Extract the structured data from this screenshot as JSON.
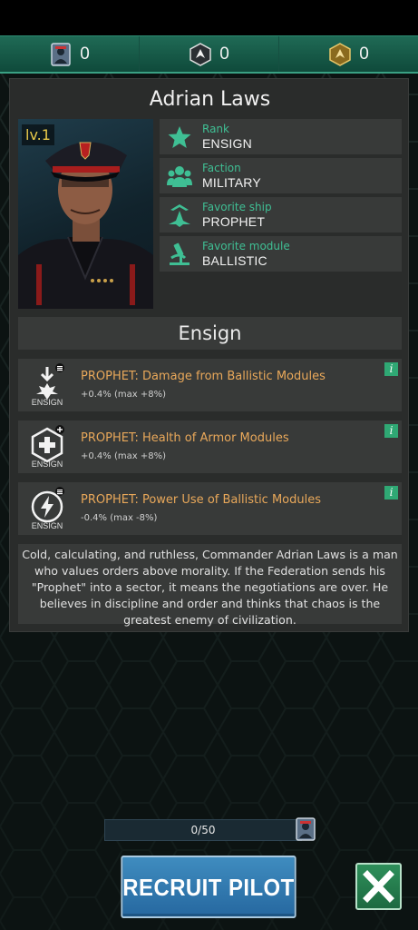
{
  "resources": [
    {
      "icon": "pilot-card-icon",
      "value": "0"
    },
    {
      "icon": "ship-token-icon",
      "value": "0"
    },
    {
      "icon": "gold-token-icon",
      "value": "0"
    }
  ],
  "pilot": {
    "name": "Adrian Laws",
    "level": "lv.1",
    "info": [
      {
        "icon": "star-icon",
        "label": "Rank",
        "value": "ENSIGN"
      },
      {
        "icon": "people-icon",
        "label": "Faction",
        "value": "MILITARY"
      },
      {
        "icon": "ship-icon",
        "label": "Favorite ship",
        "value": "PROPHET"
      },
      {
        "icon": "microscope-icon",
        "label": "Favorite module",
        "value": "BALLISTIC"
      }
    ],
    "rank_title": "Ensign",
    "skills": [
      {
        "icon": "damage-burst-icon",
        "badge_label": "ENSIGN",
        "name": "PROPHET: Damage from Ballistic Modules",
        "value": "+0.4% (max +8%)"
      },
      {
        "icon": "health-shield-icon",
        "badge_label": "ENSIGN",
        "name": "PROPHET: Health of Armor Modules",
        "value": "+0.4% (max +8%)"
      },
      {
        "icon": "power-bolt-icon",
        "badge_label": "ENSIGN",
        "name": "PROPHET: Power Use of Ballistic Modules",
        "value": "-0.4% (max -8%)"
      }
    ],
    "description": "Cold, calculating, and ruthless, Commander Adrian Laws is a man who values orders above morality. If the Federation sends his \"Prophet\" into a sector, it means the negotiations are over. He believes in discipline and order and thinks that chaos is the greatest enemy of civilization."
  },
  "recruit": {
    "progress_text": "0/50",
    "progress": 0,
    "button_label": "RECRUIT PILOT"
  },
  "colors": {
    "accent_green": "#3fbf94",
    "skill_orange": "#e9a85a",
    "level_yellow": "#e8c94a"
  }
}
